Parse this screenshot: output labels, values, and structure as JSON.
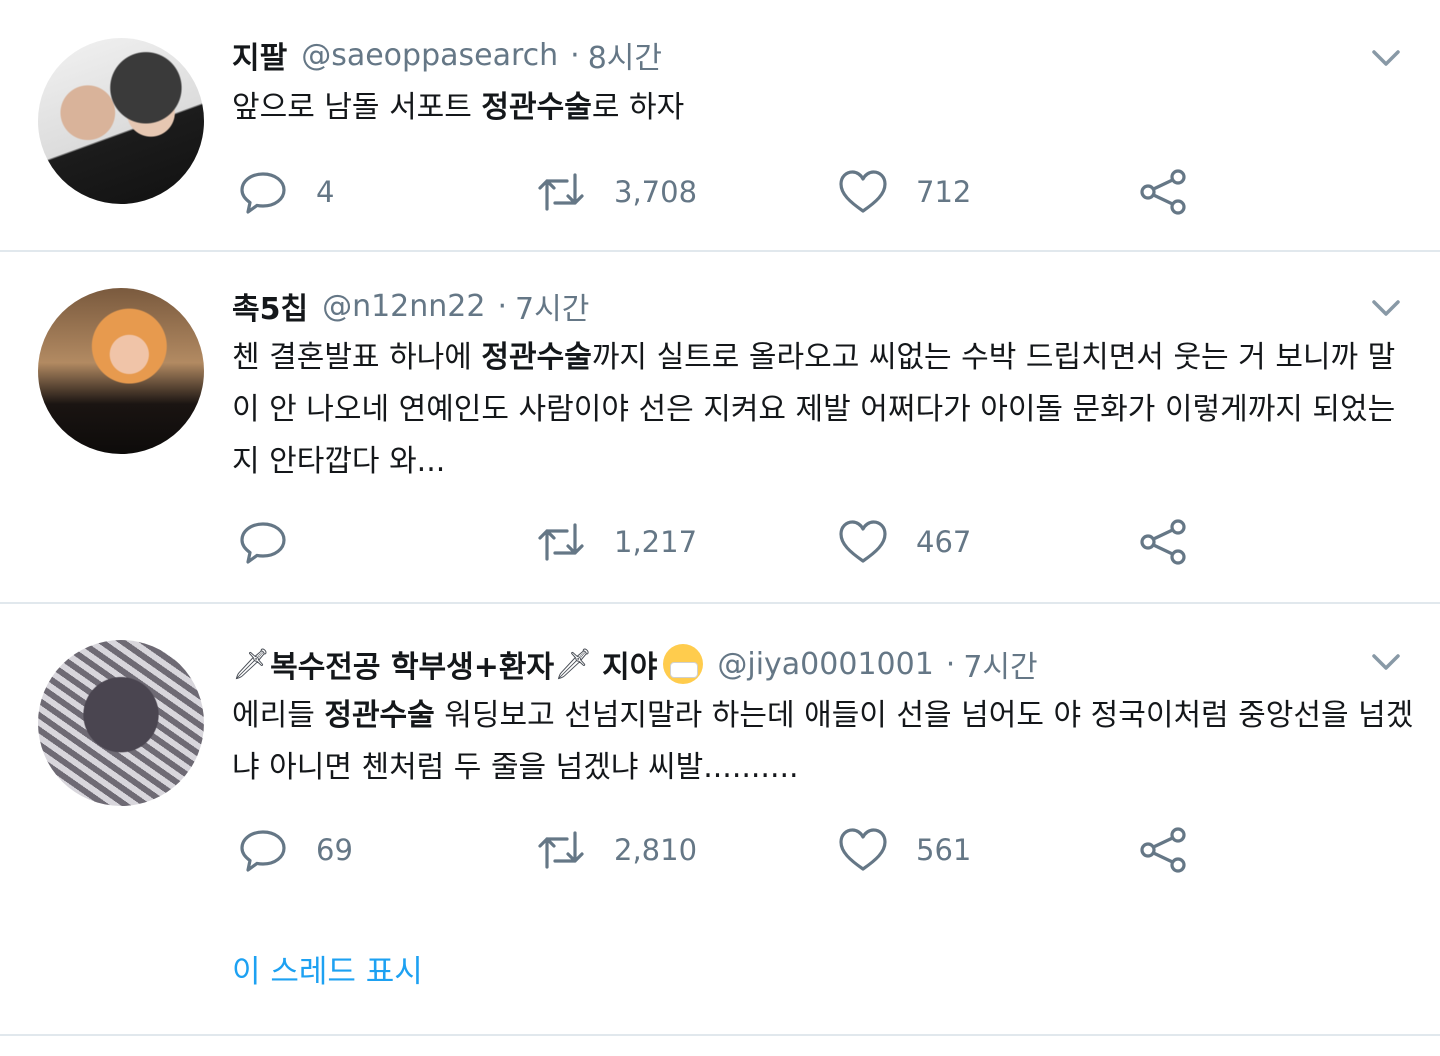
{
  "tweets": [
    {
      "name": "지팔",
      "handle": "@saeoppasearch",
      "time": "8시간",
      "text_before": "앞으로 남돌 서포트 ",
      "text_bold": "정관수술",
      "text_after": "로 하자",
      "actions": {
        "reply": "4",
        "retweet": "3,708",
        "like": "712"
      }
    },
    {
      "name": "촉5칩",
      "handle": "@n12nn22",
      "time": "7시간",
      "text_before": "첸 결혼발표 하나에 ",
      "text_bold": "정관수술",
      "text_after": "까지 실트로 올라오고 씨없는 수박 드립치면서 웃는 거 보니까 말이 안 나오네 연예인도 사람이야 선은 지켜요 제발 어쩌다가 아이돌 문화가 이렇게까지 되었는지 안타깝다 와...",
      "actions": {
        "reply": "",
        "retweet": "1,217",
        "like": "467"
      }
    },
    {
      "name_part1": "복수전공 학부생+환자",
      "name_part2": "지야",
      "handle": "@jiya0001001",
      "time": "7시간",
      "text_before": "에리들 ",
      "text_bold": "정관수술",
      "text_after": " 워딩보고 선넘지말라 하는데 애들이 선을 넘어도 야 정국이처럼 중앙선을 넘겠냐 아니면 첸처럼 두 줄을 넘겠냐 씨발..........",
      "actions": {
        "reply": "69",
        "retweet": "2,810",
        "like": "561"
      }
    }
  ],
  "thread_link": "이 스레드 표시",
  "icons": [
    "reply-icon",
    "retweet-icon",
    "like-icon",
    "share-icon",
    "chevron-down-icon",
    "dagger-icon",
    "mask-emoji-icon"
  ],
  "colors": {
    "link": "#1da1f2",
    "muted": "#657786",
    "divider": "#e1e8ed"
  }
}
